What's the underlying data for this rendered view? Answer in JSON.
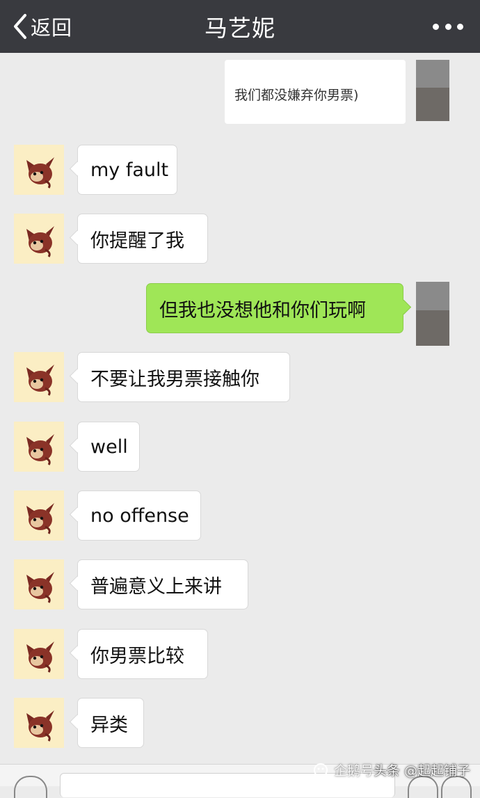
{
  "header": {
    "back_label": "返回",
    "title": "马艺妮",
    "back_icon": "chevron-left-icon",
    "more_icon": "more-dots-icon"
  },
  "colors": {
    "header_bg": "#393a3f",
    "chat_bg": "#ebebeb",
    "outgoing_bubble": "#9fe657",
    "incoming_bubble": "#ffffff",
    "avatar_bg": "#fbeec4"
  },
  "partial_message": "我们都没嫌弃你男票)",
  "messages": [
    {
      "side": "in",
      "text": "my fault"
    },
    {
      "side": "in",
      "text": "你提醒了我"
    },
    {
      "side": "out",
      "text": "但我也没想他和你们玩啊"
    },
    {
      "side": "in",
      "text": "不要让我男票接触你"
    },
    {
      "side": "in",
      "text": "well"
    },
    {
      "side": "in",
      "text": "no offense"
    },
    {
      "side": "in",
      "text": "普遍意义上来讲"
    },
    {
      "side": "in",
      "text": "你男票比较"
    },
    {
      "side": "in",
      "text": "异类"
    }
  ],
  "watermark": {
    "part1": "企鹅号",
    "part2": "头条 @起起铺子"
  }
}
